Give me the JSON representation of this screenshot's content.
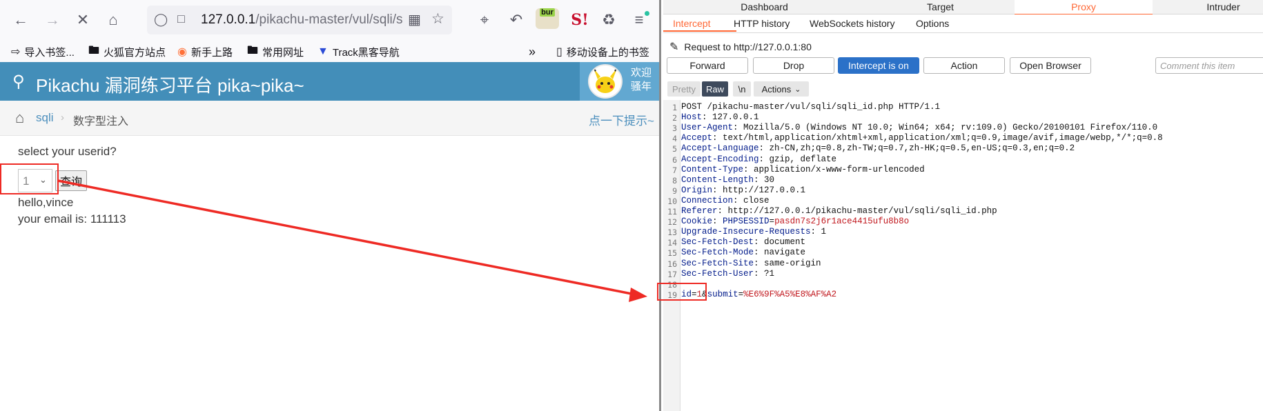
{
  "browser": {
    "url_host": "127.0.0.1",
    "url_path": "/pikachu-master/vul/sqli/s",
    "bookmarks": [
      {
        "icon": "import-icon",
        "label": "导入书签..."
      },
      {
        "icon": "folder-icon",
        "label": "火狐官方站点"
      },
      {
        "icon": "firefox-icon",
        "label": "新手上路"
      },
      {
        "icon": "folder-icon",
        "label": "常用网址"
      },
      {
        "icon": "track-icon",
        "label": "Track黑客导航"
      }
    ],
    "mobile_bookmarks": "移动设备上的书签",
    "burp_ext_label": "bur"
  },
  "pikachu": {
    "title": "Pikachu 漏洞练习平台 pika~pika~",
    "welcome_line1": "欢迎",
    "welcome_line2": "骚年",
    "breadcrumb_link": "sqli",
    "breadcrumb_current": "数字型注入",
    "hint_link": "点一下提示~",
    "question": "select your userid?",
    "select_value": "1",
    "query_button": "查询",
    "result_hello": "hello,vince",
    "result_email": "your email is: 111113"
  },
  "burp": {
    "top_tabs": [
      "Dashboard",
      "Target",
      "Proxy",
      "Intruder"
    ],
    "active_top_tab": "Proxy",
    "sub_tabs": [
      "Intercept",
      "HTTP history",
      "WebSockets history",
      "Options"
    ],
    "active_sub_tab": "Intercept",
    "request_to": "Request to http://127.0.0.1:80",
    "buttons": {
      "forward": "Forward",
      "drop": "Drop",
      "intercept": "Intercept is on",
      "action": "Action",
      "open_browser": "Open Browser"
    },
    "comment_placeholder": "Comment this item",
    "view_tabs": {
      "pretty": "Pretty",
      "raw": "Raw",
      "newline": "\\n",
      "actions": "Actions"
    },
    "request_lines": [
      {
        "n": "1",
        "key": "",
        "val": "POST /pikachu-master/vul/sqli/sqli_id.php HTTP/1.1"
      },
      {
        "n": "2",
        "key": "Host",
        "val": "127.0.0.1"
      },
      {
        "n": "3",
        "key": "User-Agent",
        "val": "Mozilla/5.0 (Windows NT 10.0; Win64; x64; rv:109.0) Gecko/20100101 Firefox/110.0"
      },
      {
        "n": "4",
        "key": "Accept",
        "val": "text/html,application/xhtml+xml,application/xml;q=0.9,image/avif,image/webp,*/*;q=0.8"
      },
      {
        "n": "5",
        "key": "Accept-Language",
        "val": "zh-CN,zh;q=0.8,zh-TW;q=0.7,zh-HK;q=0.5,en-US;q=0.3,en;q=0.2"
      },
      {
        "n": "6",
        "key": "Accept-Encoding",
        "val": "gzip, deflate"
      },
      {
        "n": "7",
        "key": "Content-Type",
        "val": "application/x-www-form-urlencoded"
      },
      {
        "n": "8",
        "key": "Content-Length",
        "val": "30"
      },
      {
        "n": "9",
        "key": "Origin",
        "val": "http://127.0.0.1"
      },
      {
        "n": "10",
        "key": "Connection",
        "val": "close"
      },
      {
        "n": "11",
        "key": "Referer",
        "val": "http://127.0.0.1/pikachu-master/vul/sqli/sqli_id.php"
      },
      {
        "n": "12",
        "key": "Cookie",
        "val": ""
      },
      {
        "n": "13",
        "key": "Upgrade-Insecure-Requests",
        "val": "1"
      },
      {
        "n": "14",
        "key": "Sec-Fetch-Dest",
        "val": "document"
      },
      {
        "n": "15",
        "key": "Sec-Fetch-Mode",
        "val": "navigate"
      },
      {
        "n": "16",
        "key": "Sec-Fetch-Site",
        "val": "same-origin"
      },
      {
        "n": "17",
        "key": "Sec-Fetch-User",
        "val": "?1"
      },
      {
        "n": "18",
        "key": "",
        "val": ""
      },
      {
        "n": "19",
        "key": "",
        "val": ""
      }
    ],
    "cookie_name": "PHPSESSID",
    "cookie_value": "pasdn7s2j6r1ace4415ufu8b8o",
    "body_param1": "id",
    "body_value1": "1",
    "body_param2": "submit",
    "body_value2": "%E6%9F%A5%E8%AF%A2"
  },
  "colors": {
    "pikachu_header": "#438eb9",
    "burp_accent": "#ff6633",
    "intercept_on": "#2b71c8",
    "annotation": "#ee2a24"
  }
}
